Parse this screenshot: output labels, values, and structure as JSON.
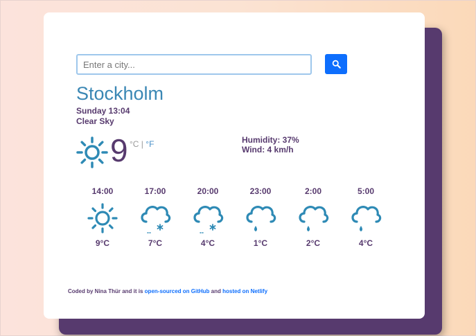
{
  "search": {
    "placeholder": "Enter a city...",
    "value": ""
  },
  "icons": {
    "search": "search-icon",
    "current": "sun-icon",
    "sun": "sun-icon",
    "snow_cloud": "snow-cloud-icon",
    "rain_cloud": "rain-cloud-icon"
  },
  "current": {
    "city": "Stockholm",
    "datetime": "Sunday 13:04",
    "description": "Clear Sky",
    "temperature": "9",
    "unit_celsius": "°C",
    "unit_separator": " | ",
    "unit_fahrenheit": "°F",
    "humidity": "Humidity: 37%",
    "wind": "Wind: 4 km/h"
  },
  "forecast": [
    {
      "time": "14:00",
      "icon": "sun",
      "temp": "9°C"
    },
    {
      "time": "17:00",
      "icon": "snow_cloud",
      "temp": "7°C"
    },
    {
      "time": "20:00",
      "icon": "snow_cloud",
      "temp": "4°C"
    },
    {
      "time": "23:00",
      "icon": "rain_cloud",
      "temp": "1°C"
    },
    {
      "time": "2:00",
      "icon": "rain_cloud",
      "temp": "2°C"
    },
    {
      "time": "5:00",
      "icon": "rain_cloud",
      "temp": "4°C"
    }
  ],
  "footer": {
    "prefix": "Coded by Nina Thür and it is ",
    "link1": "open-sourced on GitHub",
    "middle": " and ",
    "link2": "hosted on Netlify"
  },
  "colors": {
    "accent": "#0d6efd",
    "city": "#3a87b4",
    "text": "#573a6e",
    "icon": "#2e8ab5",
    "shadow_card": "#573a6e"
  }
}
